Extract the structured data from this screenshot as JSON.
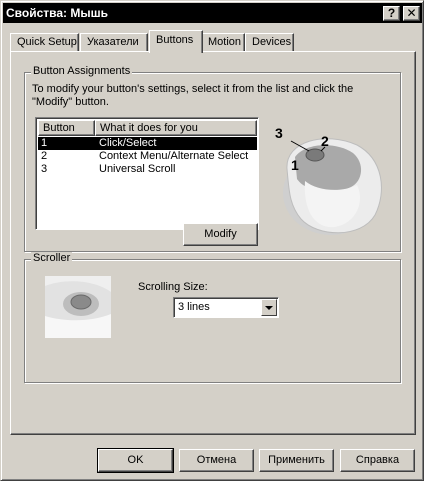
{
  "window": {
    "title": "Свойства: Мышь",
    "help_glyph": "?",
    "close_glyph": "✕"
  },
  "tabs": [
    {
      "label": "Quick Setup"
    },
    {
      "label": "Указатели"
    },
    {
      "label": "Buttons"
    },
    {
      "label": "Motion"
    },
    {
      "label": "Devices"
    }
  ],
  "button_assignments": {
    "legend": "Button Assignments",
    "instructions": "To modify your button's settings, select it from the list and click the \"Modify\" button.",
    "columns": [
      "Button",
      "What it does for you"
    ],
    "rows": [
      {
        "button": "1",
        "action": "Click/Select"
      },
      {
        "button": "2",
        "action": "Context Menu/Alternate Select"
      },
      {
        "button": "3",
        "action": "Universal Scroll"
      }
    ],
    "modify_label": "Modify",
    "mouse_labels": [
      "1",
      "2",
      "3"
    ]
  },
  "scroller": {
    "legend": "Scroller",
    "scrolling_size_label": "Scrolling Size:",
    "scrolling_size_value": "3 lines"
  },
  "footer": {
    "ok_label": "OK",
    "cancel_label": "Отмена",
    "apply_label": "Применить",
    "help_label": "Справка"
  }
}
